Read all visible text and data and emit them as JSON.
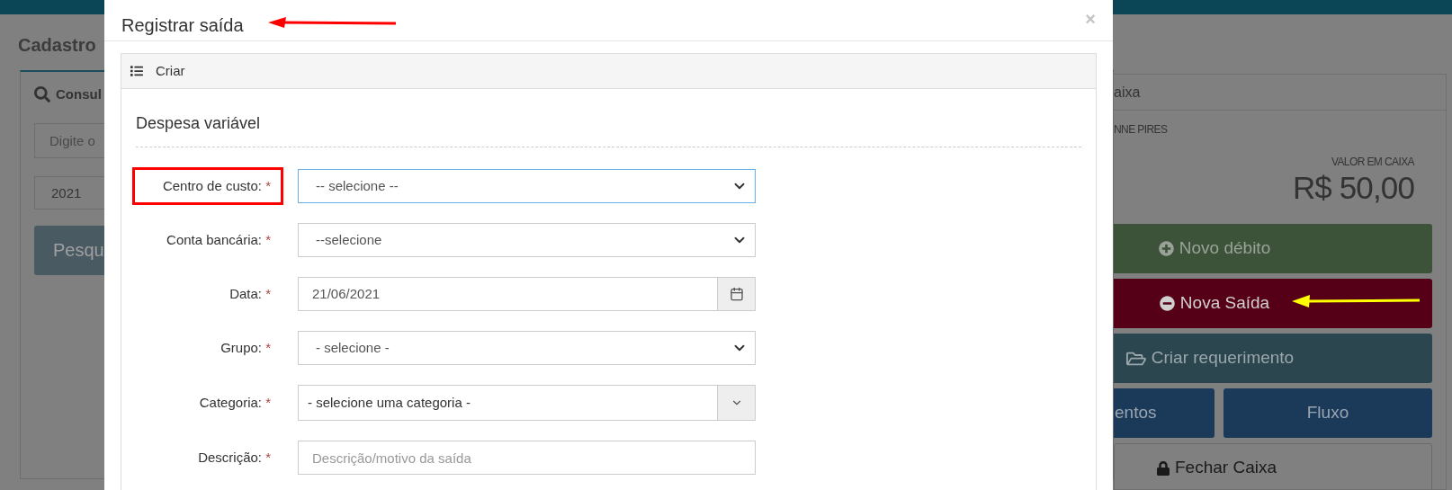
{
  "page_title": "Cadastro",
  "search_panel": {
    "title": "Consul",
    "search_field": {
      "placeholder": "Digite o"
    },
    "year_field": {
      "value": "2021"
    },
    "search_button": "Pesqu"
  },
  "cash_panel": {
    "title": "aixa",
    "operator": "NNE PIRES",
    "balance_label": "VALOR EM CAIXA",
    "balance": "R$ 50,00",
    "actions": [
      {
        "label": "Novo débito",
        "kind": "credit"
      },
      {
        "label": "Nova Saída",
        "kind": "debit"
      },
      {
        "label": "Criar requerimento",
        "kind": "request"
      }
    ],
    "split_actions": [
      {
        "label": "entos"
      },
      {
        "label": "Fluxo"
      }
    ],
    "close_button": "Fechar Caixa"
  },
  "modal": {
    "title": "Registrar saída",
    "close": "×",
    "panel_title": "Criar",
    "section_title": "Despesa variável",
    "fields": [
      {
        "label": "Centro de custo:",
        "required_mark": "*",
        "kind": "select",
        "value": "-- selecione --",
        "focused": true,
        "highlighted": true
      },
      {
        "label": "Conta bancária:",
        "required_mark": "*",
        "kind": "select",
        "value": "--selecione",
        "focused": false,
        "highlighted": false
      },
      {
        "label": "Data:",
        "required_mark": "*",
        "kind": "date",
        "value": "21/06/2021",
        "focused": false,
        "highlighted": false
      },
      {
        "label": "Grupo:",
        "required_mark": "*",
        "kind": "select",
        "value": "- selecione -",
        "focused": false,
        "highlighted": false
      },
      {
        "label": "Categoria:",
        "required_mark": "*",
        "kind": "combobox",
        "value": "- selecione uma categoria -",
        "focused": false,
        "highlighted": false
      },
      {
        "label": "Descrição:",
        "required_mark": "*",
        "kind": "text",
        "placeholder": "Descrição/motivo da saída",
        "focused": false,
        "highlighted": false
      }
    ]
  }
}
